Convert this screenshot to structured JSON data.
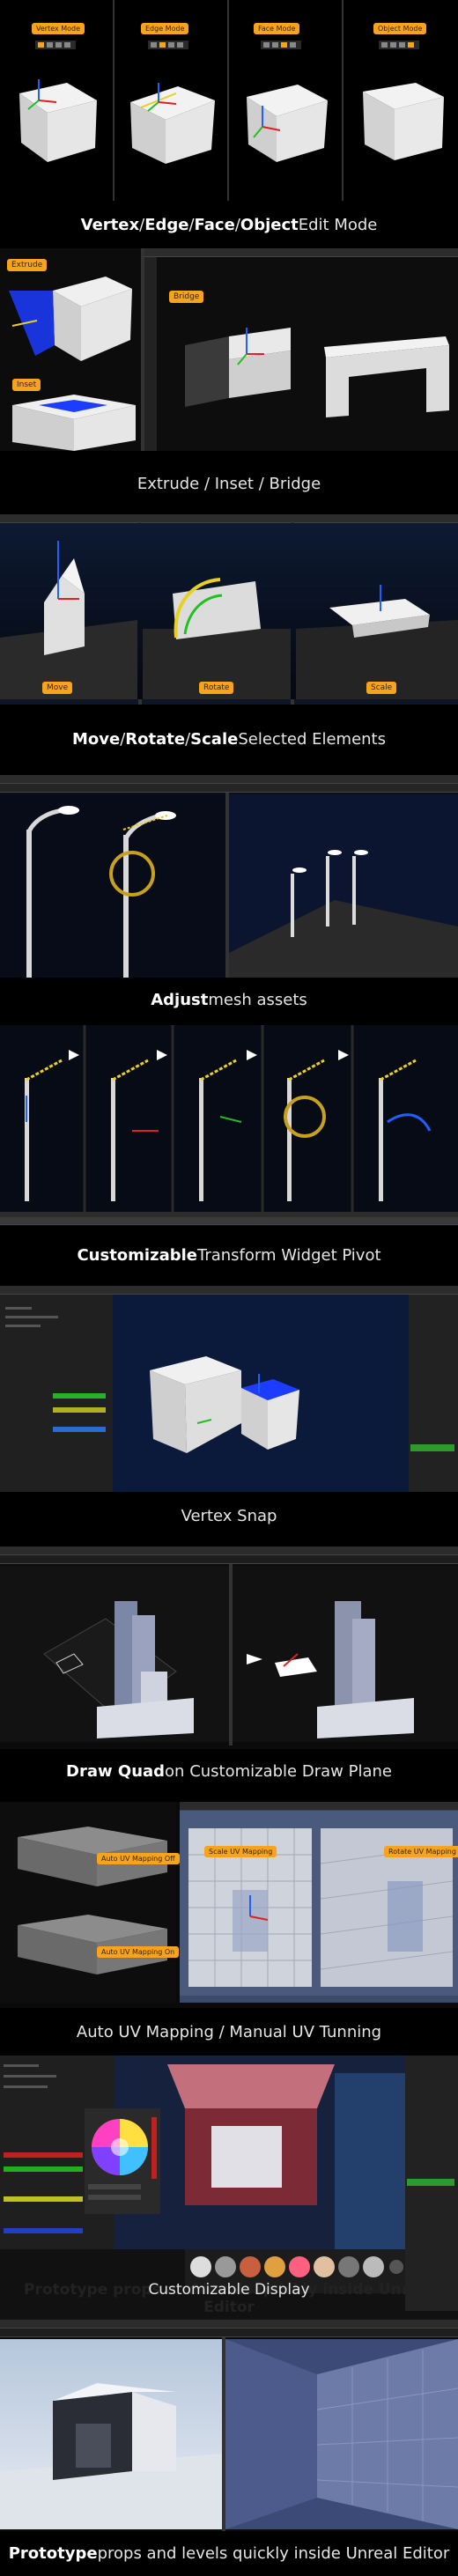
{
  "modes": {
    "vertex_label": "Vertex Mode",
    "edge_label": "Edge Mode",
    "face_label": "Face Mode",
    "object_label": "Object Mode"
  },
  "captions": {
    "c1": {
      "bold": [
        "Vertex",
        "Edge",
        "Face",
        "Object"
      ],
      "sep": " / ",
      "rest": " Edit Mode"
    },
    "c2": {
      "text": "Extrude / Inset / Bridge"
    },
    "c3": {
      "bold": [
        "Move",
        "Rotate",
        "Scale"
      ],
      "sep": " / ",
      "rest": " Selected Elements"
    },
    "c4": {
      "bold": "Adjust",
      "rest": " mesh assets"
    },
    "c5": {
      "bold": "Customizable",
      "rest": " Transform Widget Pivot"
    },
    "c6": {
      "text": "Vertex Snap"
    },
    "c7": {
      "bold": "Draw Quad",
      "rest": " on Customizable Draw Plane"
    },
    "c8": {
      "text": "Auto UV Mapping / Manual UV Tunning"
    },
    "c9": {
      "text": "Customizable Display",
      "ghost": "Prototype props and levels quickly inside Unreal Editor"
    },
    "c10": {
      "bold": "Prototype",
      "rest": " props and levels quickly inside Unreal Editor"
    }
  },
  "badges": {
    "extrude": "Extrude",
    "inset": "Inset",
    "bridge": "Bridge",
    "move": "Move",
    "rotate": "Rotate",
    "scale": "Scale",
    "uv_off": "Auto UV Mapping Off",
    "uv_on": "Auto UV Mapping On",
    "scale_uv": "Scale UV Mapping",
    "rotate_uv": "Rotate UV Mapping"
  },
  "colors": {
    "accent": "#f7a31c",
    "selection": "#1c3cff",
    "gizmo_x": "#e02020",
    "gizmo_y": "#20c020",
    "gizmo_z": "#2060ff",
    "highlight": "#e8d020"
  }
}
